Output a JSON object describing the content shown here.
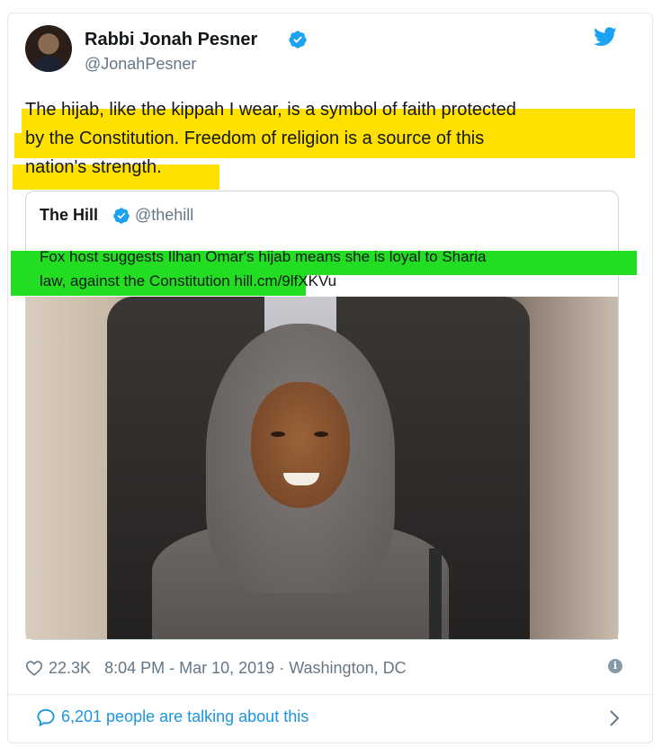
{
  "author": {
    "name": "Rabbi Jonah Pesner",
    "handle": "@JonahPesner"
  },
  "tweet": {
    "line1": "The hijab, like the kippah I wear, is a symbol of faith protected",
    "line2": "by the Constitution. Freedom of religion is a source of this",
    "line3": "nation's strength."
  },
  "quoted": {
    "name": "The Hill",
    "handle": "@thehill",
    "line1": "Fox host suggests Ilhan Omar's hijab means she is loyal to Sharia",
    "line2": "law, against the Constitution hill.",
    "line2_link": "cm/9lfXKVu"
  },
  "meta": {
    "likes": "22.3K",
    "time": "8:04 PM - Mar 10, 2019",
    "separator": "·",
    "location": "Washington, DC"
  },
  "footer": {
    "talking": "6,201 people are talking about this"
  },
  "colors": {
    "highlight_yellow": "#ffe100",
    "highlight_green": "#22dd22",
    "twitter_blue": "#1da1f2",
    "link_blue": "#1b95e0"
  },
  "icons": [
    "verified-badge-icon",
    "twitter-bird-icon",
    "heart-icon",
    "info-icon",
    "speech-bubble-icon",
    "chevron-right-icon"
  ]
}
